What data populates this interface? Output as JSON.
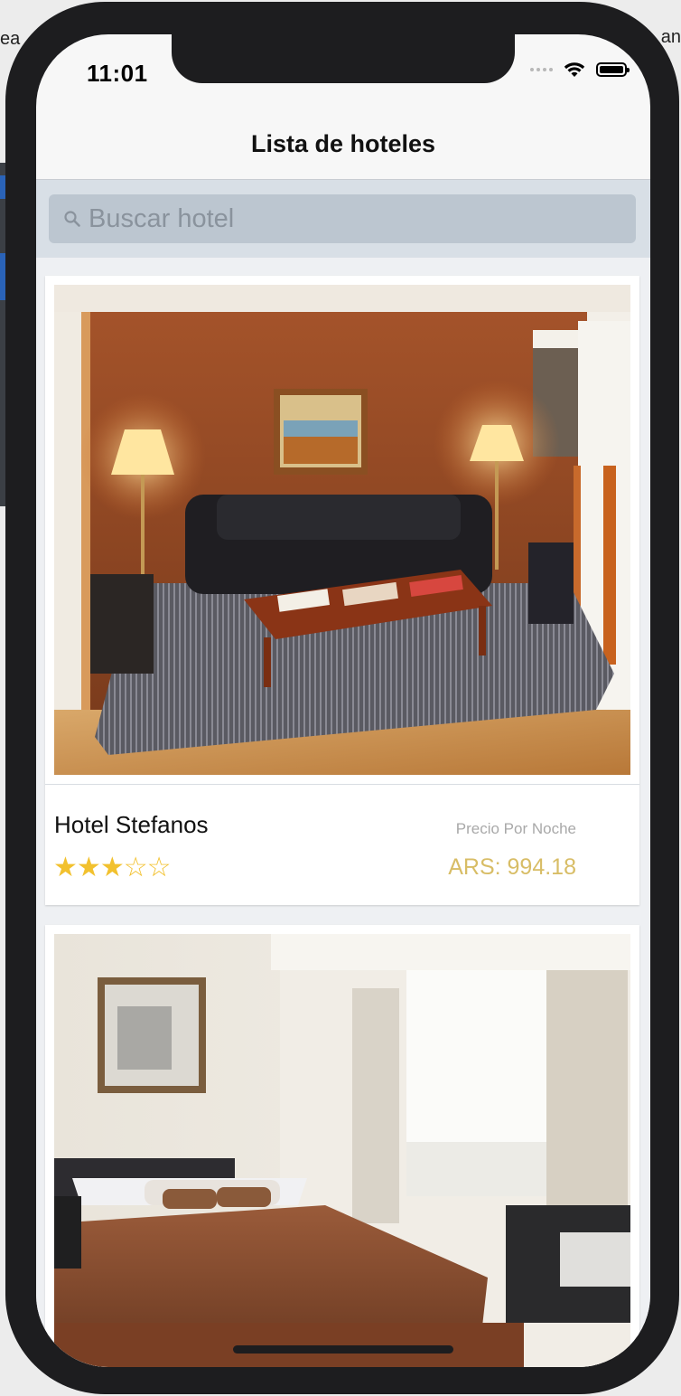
{
  "background": {
    "left_text": "ea",
    "right_text": "an"
  },
  "status_bar": {
    "time": "11:01"
  },
  "nav": {
    "title": "Lista de hoteles"
  },
  "search": {
    "placeholder": "Buscar hotel",
    "value": ""
  },
  "hotels": [
    {
      "name": "Hotel Stefanos",
      "rating": 3,
      "max_rating": 5,
      "price_label": "Precio Por Noche",
      "price": "ARS: 994.18"
    }
  ],
  "colors": {
    "star": "#f2c12e",
    "price": "#d8bd66",
    "search_bg": "#bcc6d0"
  }
}
